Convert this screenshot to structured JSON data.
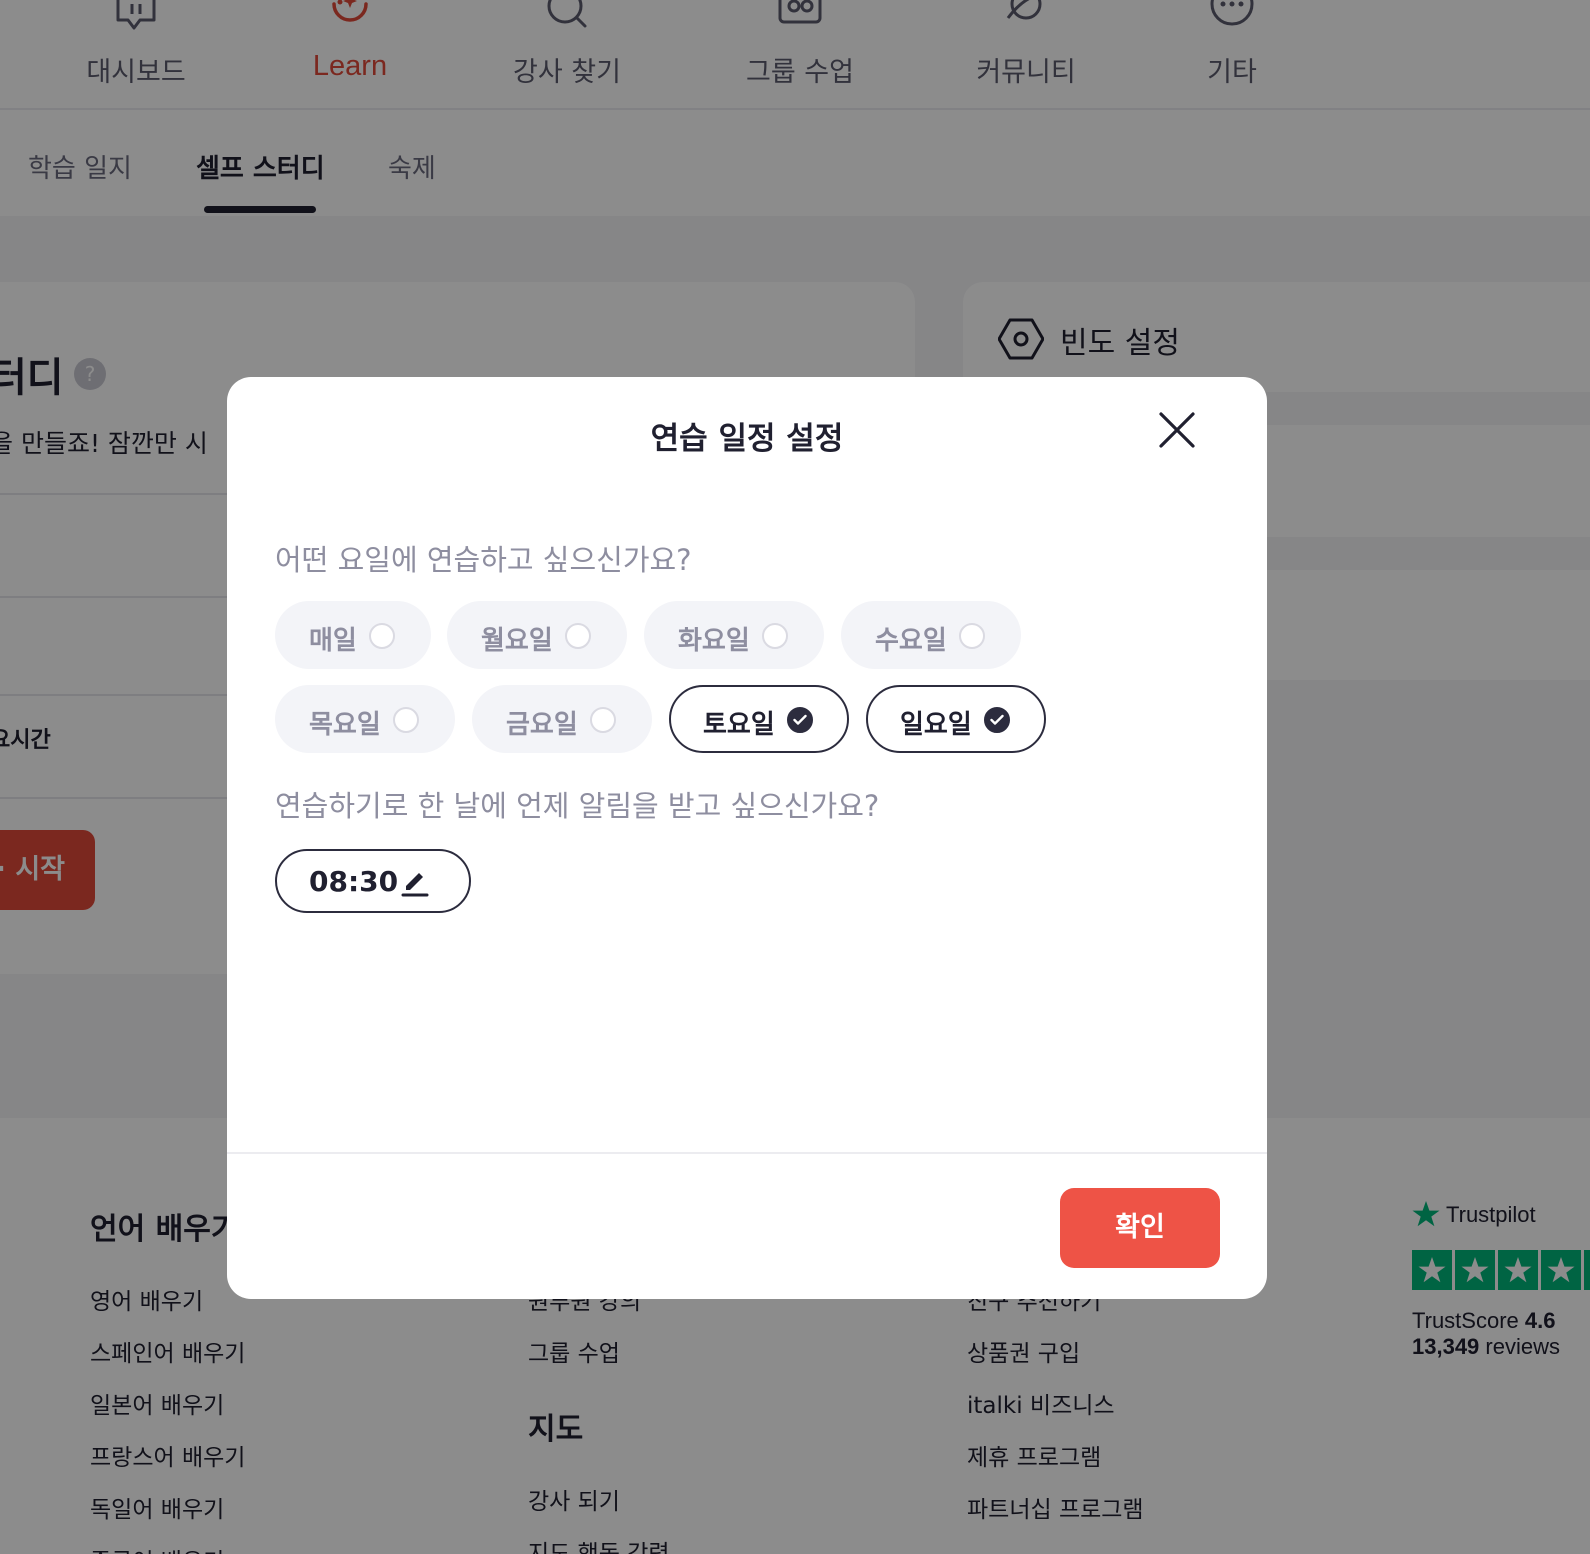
{
  "nav": {
    "items": [
      {
        "label": "대시보드",
        "icon": "chat-icon",
        "active": false
      },
      {
        "label": "Learn",
        "icon": "learn-icon",
        "active": true
      },
      {
        "label": "강사 찾기",
        "icon": "search-icon",
        "active": false
      },
      {
        "label": "그룹 수업",
        "icon": "group-icon",
        "active": false
      },
      {
        "label": "커뮤니티",
        "icon": "planet-icon",
        "active": false
      },
      {
        "label": "기타",
        "icon": "more-icon",
        "active": false
      }
    ]
  },
  "subtabs": {
    "items": [
      {
        "label": "학습 일지",
        "active": false
      },
      {
        "label": "셀프 스터디",
        "active": true
      },
      {
        "label": "숙제",
        "active": false
      }
    ]
  },
  "left_card": {
    "title": "터디",
    "help": "?",
    "description": "을 만들죠! 잠깐만 시",
    "row_label": "요시간",
    "start_button": "· 시작"
  },
  "right_card": {
    "title": "빈도 설정",
    "icon": "settings-icon"
  },
  "footer": {
    "col1": {
      "heading": "언어 배우기",
      "links": [
        "영어 배우기",
        "스페인어 배우기",
        "일본어 배우기",
        "프랑스어 배우기",
        "독일어 배우기",
        "중국어 배우기"
      ]
    },
    "col2": {
      "links_top": [
        "원루원 강의",
        "그룹 수업"
      ],
      "heading": "지도",
      "links": [
        "강사 되기",
        "지도 행동 강령"
      ]
    },
    "col3": {
      "links": [
        "친구 추천하기",
        "상품권 구입",
        "italki 비즈니스",
        "제휴 프로그램",
        "파트너십 프로그램"
      ]
    },
    "trustpilot": {
      "brand": "Trustpilot",
      "score_label": "TrustScore",
      "score": "4.6",
      "reviews_count": "13,349",
      "reviews_label": "reviews",
      "rating": 4.5,
      "color": "#00b67a"
    }
  },
  "modal": {
    "title": "연습 일정 설정",
    "days_question": "어떤 요일에 연습하고 싶으신가요?",
    "days": [
      {
        "label": "매일",
        "selected": false
      },
      {
        "label": "월요일",
        "selected": false
      },
      {
        "label": "화요일",
        "selected": false
      },
      {
        "label": "수요일",
        "selected": false
      },
      {
        "label": "목요일",
        "selected": false
      },
      {
        "label": "금요일",
        "selected": false
      },
      {
        "label": "토요일",
        "selected": true
      },
      {
        "label": "일요일",
        "selected": true
      }
    ],
    "time_question": "연습하기로 한 날에 언제 알림을 받고 싶으신가요?",
    "time_value": "08:30",
    "confirm_label": "확인",
    "accent_color": "#ee5346"
  }
}
